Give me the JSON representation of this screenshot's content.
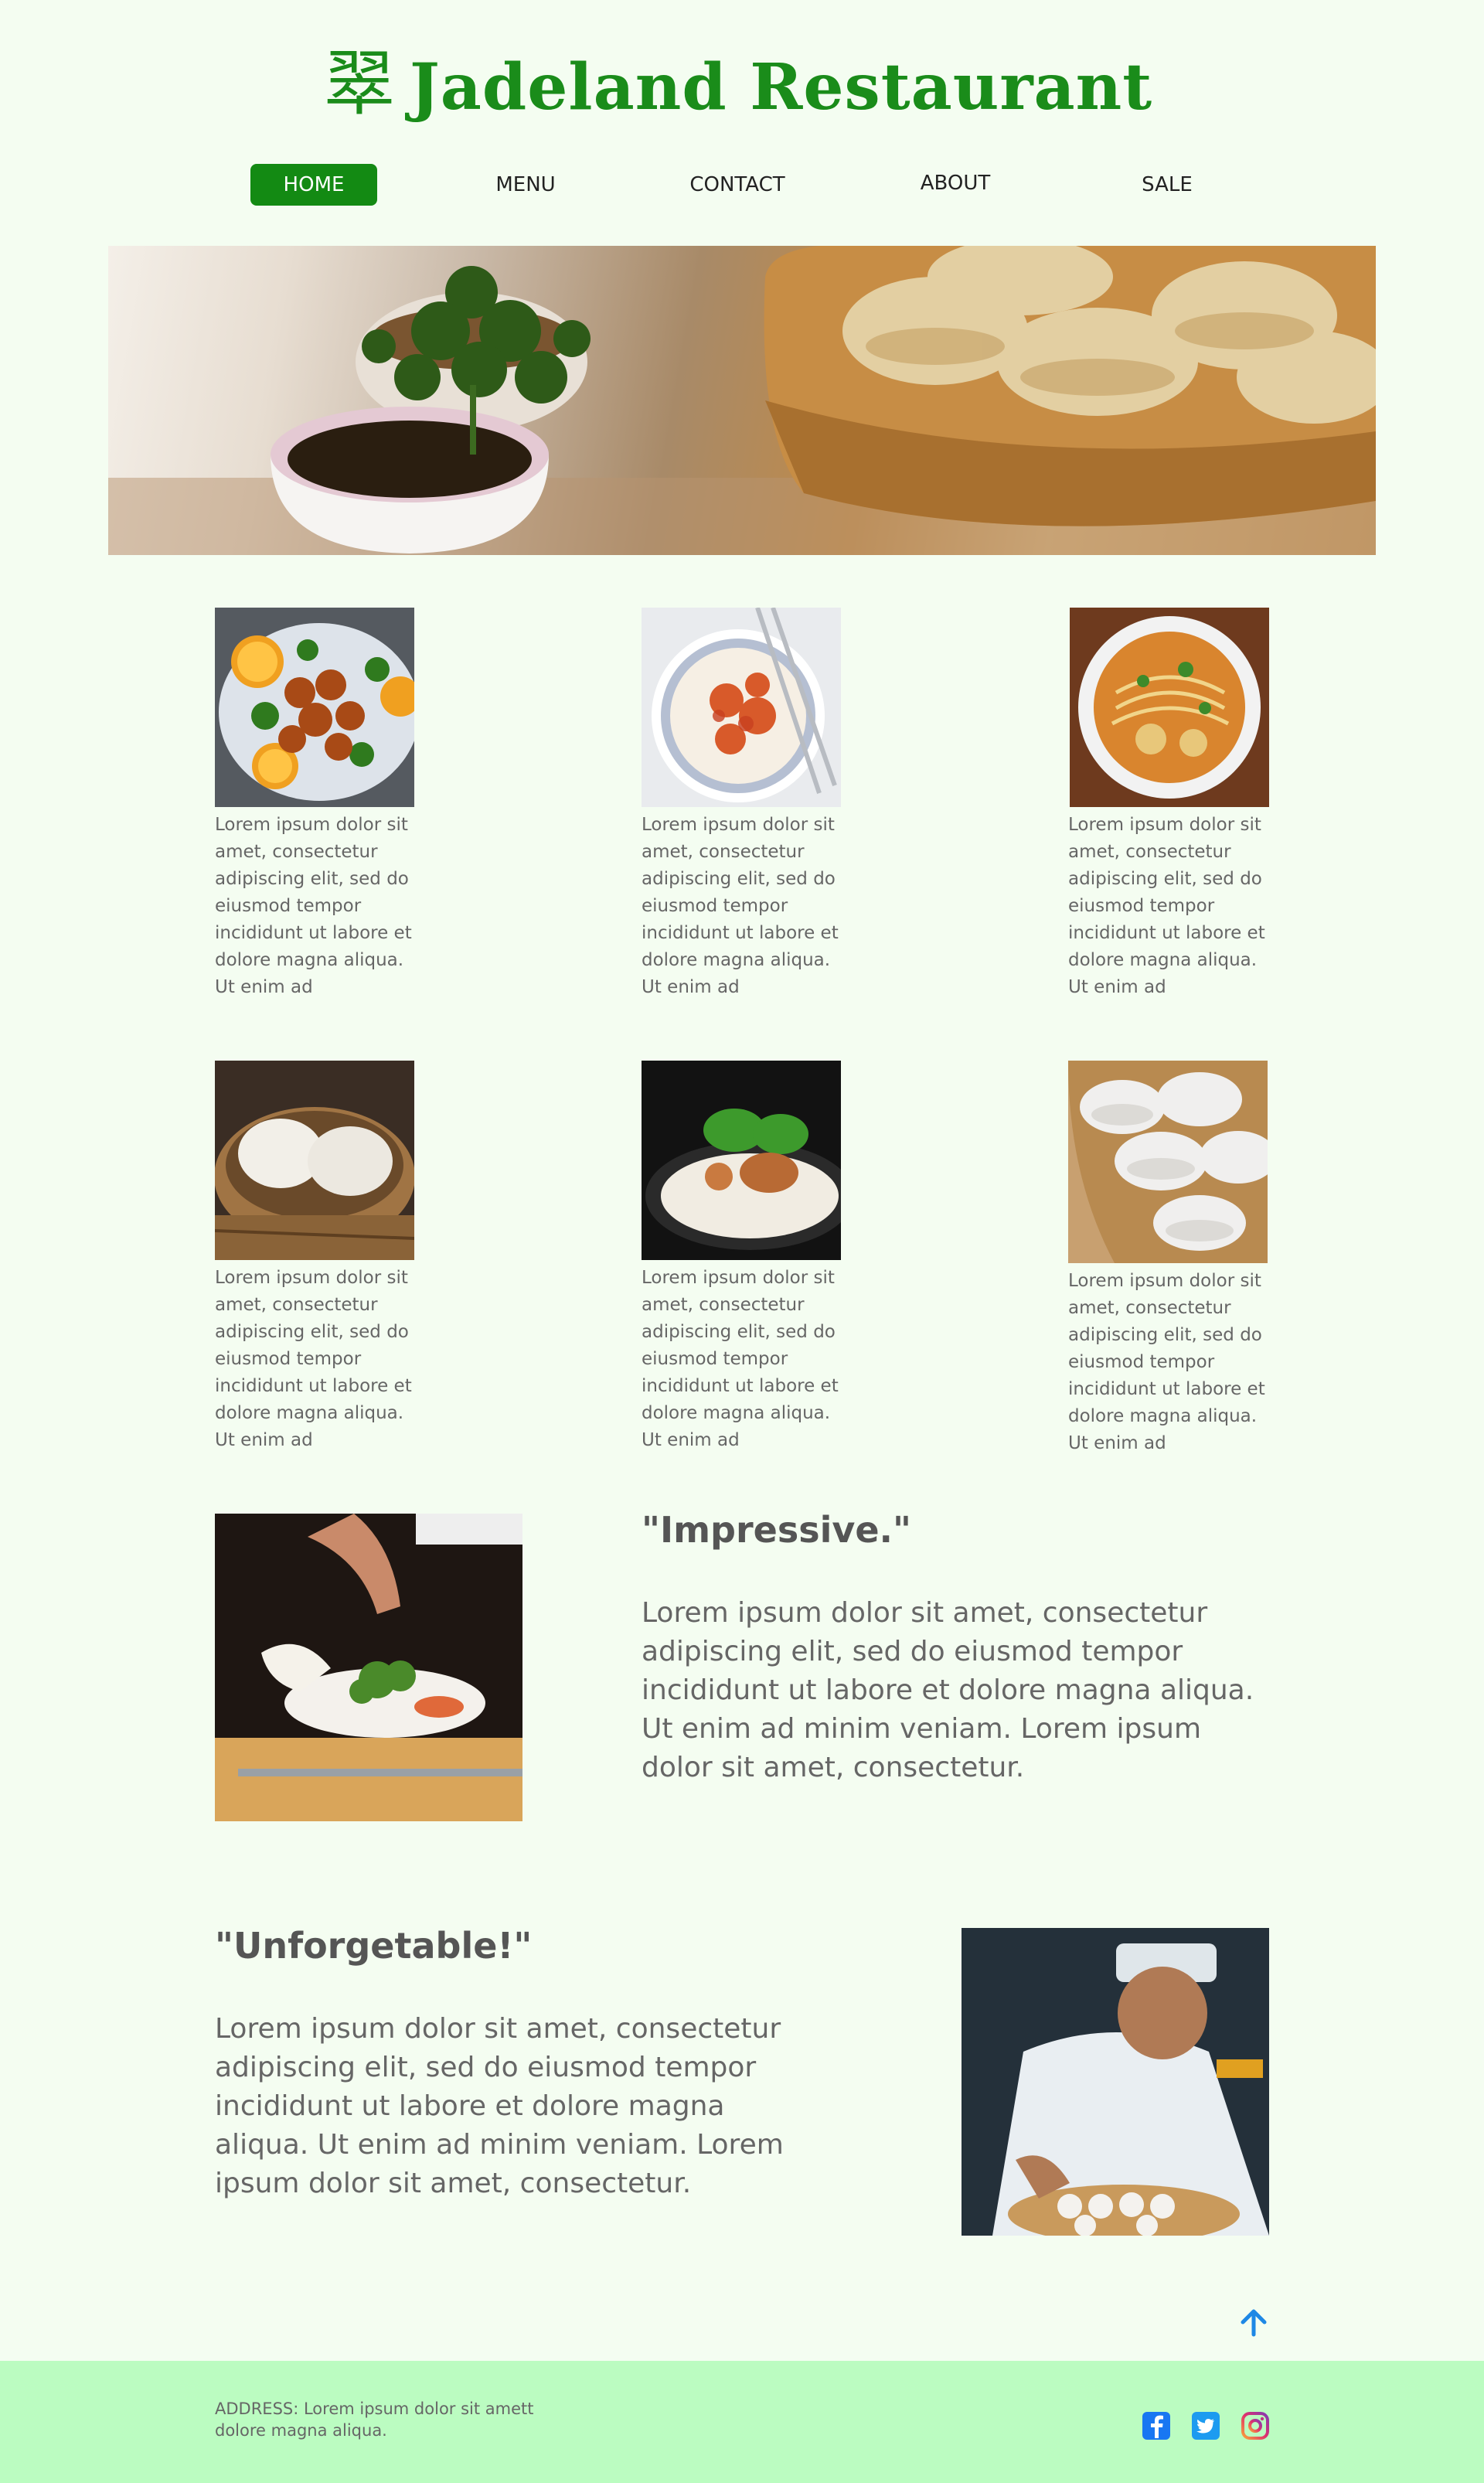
{
  "header": {
    "logo_glyph": "翠",
    "title": "Jadeland Restaurant"
  },
  "nav": {
    "home": "HOME",
    "menu": "MENU",
    "contact": "CONTACT",
    "about": "ABOUT",
    "sale": "SALE"
  },
  "menu_items": [
    {
      "text": "Lorem ipsum dolor sit amet, consectetur adipiscing elit, sed do eiusmod tempor incididunt ut labore et dolore magna aliqua. Ut enim ad"
    },
    {
      "text": "Lorem ipsum dolor sit amet, consectetur adipiscing elit, sed do eiusmod tempor incididunt ut labore et dolore magna aliqua. Ut enim ad"
    },
    {
      "text": "Lorem ipsum dolor sit amet, consectetur adipiscing elit, sed do eiusmod tempor incididunt ut labore et dolore magna aliqua. Ut enim ad"
    },
    {
      "text": "Lorem ipsum dolor sit amet, consectetur adipiscing elit, sed do eiusmod tempor incididunt ut labore et dolore magna aliqua. Ut enim ad"
    },
    {
      "text": "Lorem ipsum dolor sit amet, consectetur adipiscing elit, sed do eiusmod tempor incididunt ut labore et dolore magna aliqua. Ut enim ad"
    },
    {
      "text": "Lorem ipsum dolor sit amet, consectetur adipiscing elit, sed do eiusmod tempor incididunt ut labore et dolore magna aliqua. Ut enim ad"
    }
  ],
  "testimonials": [
    {
      "title": "\"Impressive.\"",
      "body": "Lorem ipsum dolor sit amet, consectetur adipiscing elit, sed do eiusmod tempor incididunt ut labore et dolore magna aliqua. Ut enim ad minim veniam. Lorem ipsum dolor sit amet, consectetur."
    },
    {
      "title": "\"Unforgetable!\"",
      "body": "Lorem ipsum dolor sit amet, consectetur adipiscing elit, sed do eiusmod tempor incididunt ut labore et dolore magna aliqua. Ut enim ad minim veniam. Lorem ipsum dolor sit amet, consectetur."
    }
  ],
  "footer": {
    "address": "ADDRESS: Lorem ipsum dolor sit amett dolore magna aliqua.",
    "social": [
      "facebook-icon",
      "twitter-icon",
      "instagram-icon"
    ]
  },
  "colors": {
    "brand_green": "#1a8c1a",
    "nav_active": "#138a13",
    "page_bg": "#f4fdf1",
    "footer_bg": "#bbfcc1",
    "scroll_top": "#1e88e5"
  }
}
